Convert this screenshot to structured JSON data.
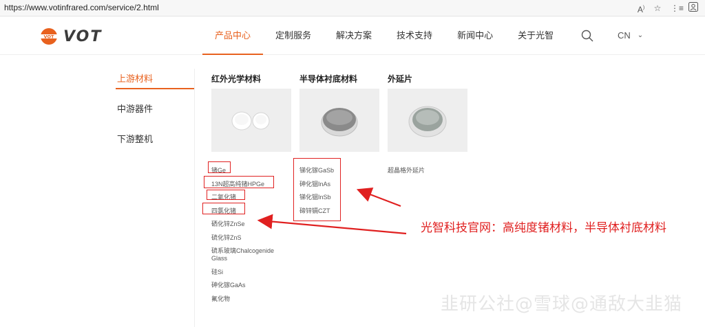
{
  "browser": {
    "url": "https://www.votinfrared.com/service/2.html",
    "toolbar_icons": [
      "read-aloud-icon",
      "favorite-star-icon",
      "collections-icon",
      "profile-icon"
    ]
  },
  "site": {
    "logo_mark": "VOT",
    "brand": "VOT",
    "nav": [
      {
        "label": "产品中心",
        "active": true
      },
      {
        "label": "定制服务",
        "active": false
      },
      {
        "label": "解决方案",
        "active": false
      },
      {
        "label": "技术支持",
        "active": false
      },
      {
        "label": "新闻中心",
        "active": false
      },
      {
        "label": "关于光智",
        "active": false
      }
    ],
    "lang": "CN",
    "accent": "#e8611e"
  },
  "sidebar": {
    "items": [
      {
        "label": "上游材料",
        "active": true
      },
      {
        "label": "中游器件",
        "active": false
      },
      {
        "label": "下游整机",
        "active": false
      }
    ]
  },
  "columns": [
    {
      "title": "红外光学材料",
      "items": [
        "锗Ge",
        "13N超高纯锗HPGe",
        "二氧化锗",
        "四氯化锗",
        "硒化锌ZnSe",
        "硫化锌ZnS",
        "硫系玻璃Chalcogenide Glass",
        "硅Si",
        "砷化镓GaAs",
        "氟化物"
      ]
    },
    {
      "title": "半导体衬底材料",
      "items": [
        "锑化镓GaSb",
        "砷化铟InAs",
        "锑化铟InSb",
        "碲锌镉CZT"
      ]
    },
    {
      "title": "外延片",
      "items": [
        "超晶格外延片"
      ]
    }
  ],
  "annotation": {
    "caption": "光智科技官网：高纯度锗材料，半导体衬底材料",
    "color": "#e02020"
  },
  "watermark": "韭研公社@雪球@通敌大韭猫"
}
